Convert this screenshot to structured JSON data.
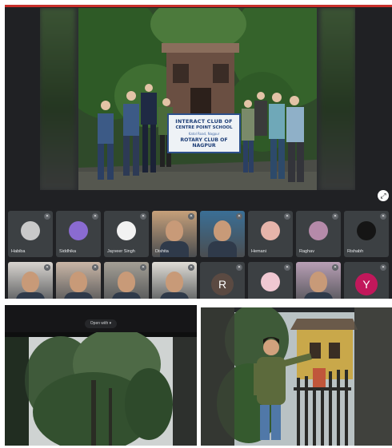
{
  "banner": {
    "line1": "INTERACT CLUB OF",
    "line2": "CENTRE POINT SCHOOL",
    "line3": "Katol Road, Nagpur",
    "line4": "ROTARY CLUB OF NAGPUR"
  },
  "participants_row1": [
    {
      "name": "Habiba",
      "kind": "avatar",
      "color": "#c9c9c9"
    },
    {
      "name": "Siddhika",
      "kind": "avatar",
      "color": "#8a6bd1"
    },
    {
      "name": "Jayveer Singh",
      "kind": "avatar",
      "color": "#f2f2f2"
    },
    {
      "name": "Dishita",
      "kind": "video",
      "color": "#c6a07a"
    },
    {
      "name": "",
      "kind": "video",
      "color": "#3a6f96"
    },
    {
      "name": "Hemani",
      "kind": "avatar",
      "color": "#e6b4aa"
    },
    {
      "name": "Raghav",
      "kind": "avatar",
      "color": "#b58aa9"
    },
    {
      "name": "Rishabh",
      "kind": "avatar",
      "color": "#151515"
    }
  ],
  "participants_row2": [
    {
      "kind": "video",
      "color": "#d8d4cf"
    },
    {
      "kind": "video",
      "color": "#c9b6a6"
    },
    {
      "kind": "video",
      "color": "#a49f95"
    },
    {
      "kind": "video",
      "color": "#e0ddd6"
    },
    {
      "kind": "letter",
      "letter": "R",
      "color": "#5b4a42"
    },
    {
      "kind": "avatar",
      "color": "#f0c8d2"
    },
    {
      "kind": "video",
      "color": "#b89fb5"
    },
    {
      "kind": "letter",
      "letter": "Y",
      "color": "#c2185b"
    }
  ],
  "bottom_left": {
    "pill_label": "Open with ▾"
  },
  "icons": {
    "corner_button": "expand-icon",
    "mic": "mic-off-icon"
  }
}
